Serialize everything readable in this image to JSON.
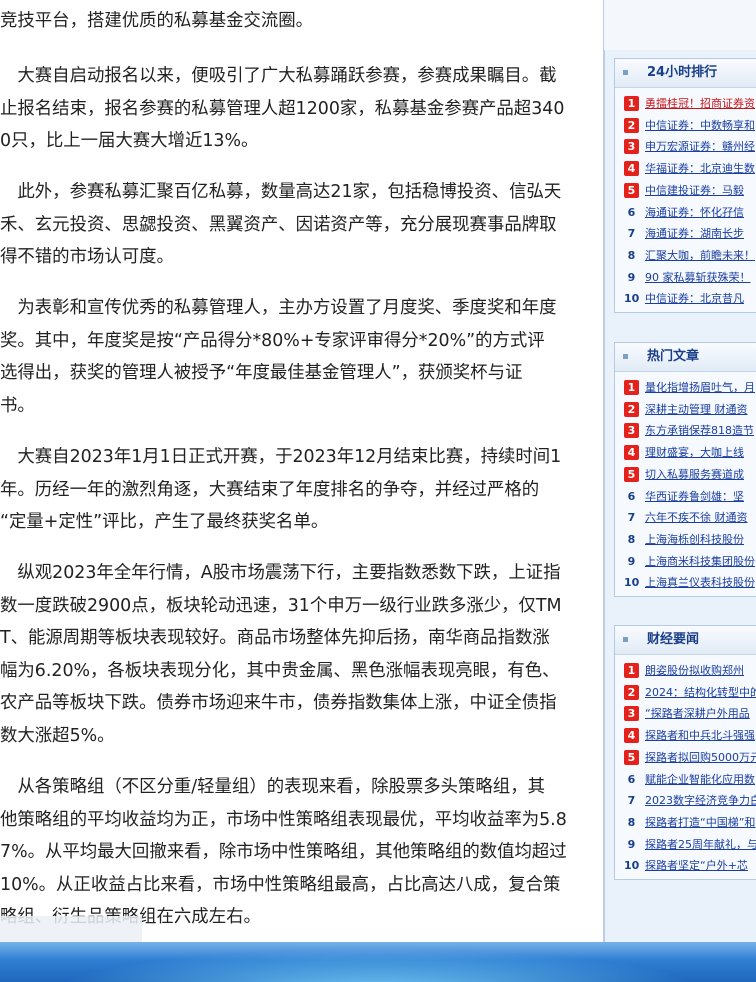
{
  "article": {
    "paragraphs": [
      [
        "竞技平台，搭建优质的私募基金交流圈。"
      ],
      [
        "　大赛自启动报名以来，便吸引了广大私募踊跃参赛，参赛成果瞩目。截",
        "止报名结束，报名参赛的私募管理人超1200家，私募基金参赛产品超340",
        "0只，比上一届大赛大增近13%。"
      ],
      [
        "　此外，参赛私募汇聚百亿私募，数量高达21家，包括稳博投资、信弘天",
        "禾、玄元投资、思勰投资、黑翼资产、因诺资产等，充分展现赛事品牌取",
        "得不错的市场认可度。"
      ],
      [
        "　为表彰和宣传优秀的私募管理人，主办方设置了月度奖、季度奖和年度",
        "奖。其中，年度奖是按“产品得分*80%+专家评审得分*20%”的方式评",
        "选得出，获奖的管理人被授予“年度最佳基金管理人”，获颁奖杯与证",
        "书。"
      ],
      [
        "　大赛自2023年1月1日正式开赛，于2023年12月结束比赛，持续时间1",
        "年。历经一年的激烈角逐，大赛结束了年度排名的争夺，并经过严格的",
        "“定量+定性”评比，产生了最终获奖名单。"
      ],
      [
        "　纵观2023年全年行情，A股市场震荡下行，主要指数悉数下跌，上证指",
        "数一度跌破2900点，板块轮动迅速，31个申万一级行业跌多涨少，仅TM",
        "T、能源周期等板块表现较好。商品市场整体先抑后扬，南华商品指数涨",
        "幅为6.20%，各板块表现分化，其中贵金属、黑色涨幅表现亮眼，有色、",
        "农产品等板块下跌。债券市场迎来牛市，债券指数集体上涨，中证全债指",
        "数大涨超5%。"
      ],
      [
        "　从各策略组（不区分重/轻量组）的表现来看，除股票多头策略组，其",
        "他策略组的平均收益均为正，市场中性策略组表现最优，平均收益率为5.8",
        "7%。从平均最大回撤来看，除市场中性策略组，其他策略组的数值均超过",
        "10%。从正收益占比来看，市场中性策略组最高，占比高达八成，复合策",
        "略组、衍生品策略组在六成左右。"
      ]
    ]
  },
  "sidebar": {
    "boxes": [
      {
        "title": "24小时排行",
        "items": [
          {
            "num": "1",
            "text": "勇擂桂冠！招商证券资",
            "red": true
          },
          {
            "num": "2",
            "text": "中信证券：中数畅享和",
            "red": false
          },
          {
            "num": "3",
            "text": "申万宏源证券：赣州经",
            "red": false
          },
          {
            "num": "4",
            "text": "华福证券：北京迪生数",
            "red": false
          },
          {
            "num": "5",
            "text": "中信建投证券：马毅",
            "red": false
          },
          {
            "num": "6",
            "text": "海通证券：怀化孖信",
            "red": false
          },
          {
            "num": "7",
            "text": "海通证券：湖南长步",
            "red": false
          },
          {
            "num": "8",
            "text": "汇聚大咖，前瞻未来！",
            "red": false
          },
          {
            "num": "9",
            "text": "90 家私募斩获殊荣！",
            "red": false
          },
          {
            "num": "10",
            "text": "中信证券：北京昔凡",
            "red": false
          }
        ]
      },
      {
        "title": "热门文章",
        "items": [
          {
            "num": "1",
            "text": "量化指增扬眉吐气，月",
            "red": false
          },
          {
            "num": "2",
            "text": "深耕主动管理 财通资",
            "red": false
          },
          {
            "num": "3",
            "text": "东方承销保荐818造节",
            "red": false
          },
          {
            "num": "4",
            "text": "理财盛宴，大咖上线",
            "red": false
          },
          {
            "num": "5",
            "text": "切入私募服务赛道成",
            "red": false
          },
          {
            "num": "6",
            "text": "华西证券鲁剑雄：坚",
            "red": false
          },
          {
            "num": "7",
            "text": "六年不疾不徐 财通资",
            "red": false
          },
          {
            "num": "8",
            "text": "上海海栎创科技股份",
            "red": false
          },
          {
            "num": "9",
            "text": "上海商米科技集团股份",
            "red": false
          },
          {
            "num": "10",
            "text": "上海真兰仪表科技股份",
            "red": false
          }
        ]
      },
      {
        "title": "财经要闻",
        "items": [
          {
            "num": "1",
            "text": "朗姿股份拟收购郑州",
            "red": false
          },
          {
            "num": "2",
            "text": "2024：结构化转型中的",
            "red": false
          },
          {
            "num": "3",
            "text": "“探路者深耕户外用品",
            "red": false
          },
          {
            "num": "4",
            "text": "探路者和中兵北斗强强",
            "red": false
          },
          {
            "num": "5",
            "text": "探路者拟回购5000万元",
            "red": false
          },
          {
            "num": "6",
            "text": "赋能企业智能化应用数",
            "red": false
          },
          {
            "num": "7",
            "text": "2023数字经济竞争力白",
            "red": false
          },
          {
            "num": "8",
            "text": "探路者打造“中国梯”和",
            "red": false
          },
          {
            "num": "9",
            "text": "探路者25周年献礼，与",
            "red": false
          },
          {
            "num": "10",
            "text": "探路者坚定“户外+芯",
            "red": false
          }
        ]
      }
    ]
  }
}
